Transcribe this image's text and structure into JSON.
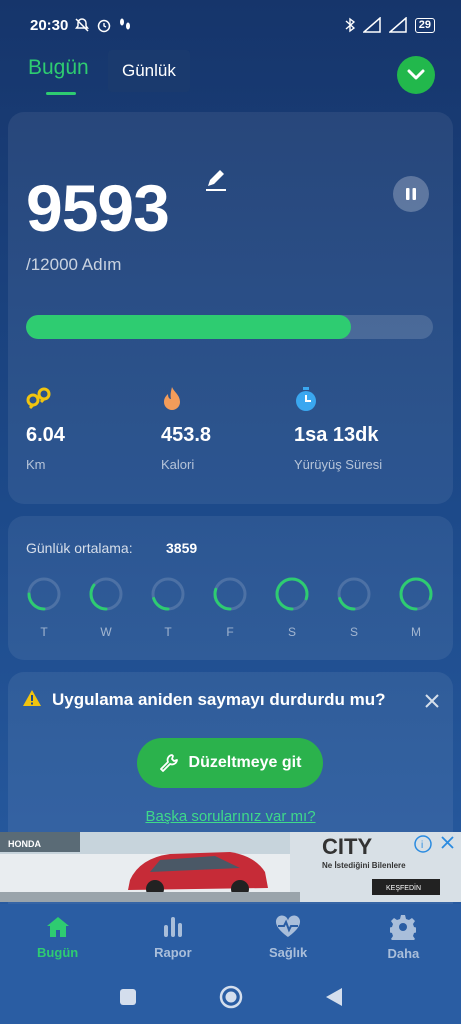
{
  "status_bar": {
    "time": "20:30",
    "battery": "29"
  },
  "tabs": {
    "today": "Bugün",
    "daily": "Günlük"
  },
  "steps": {
    "count": "9593",
    "goal_text": "/12000 Adım",
    "progress": 0.7994
  },
  "stats": [
    {
      "value": "6.04",
      "label": "Km",
      "icon": "distance-icon"
    },
    {
      "value": "453.8",
      "label": "Kalori",
      "icon": "fire-icon"
    },
    {
      "value": "1sa 13dk",
      "label": "Yürüyüş Süresi",
      "icon": "stopwatch-icon"
    }
  ],
  "daily_average": {
    "label": "Günlük ortalama:",
    "value": "3859",
    "days": [
      {
        "label": "T",
        "progress": 0.25
      },
      {
        "label": "W",
        "progress": 0.35
      },
      {
        "label": "T",
        "progress": 0.2
      },
      {
        "label": "F",
        "progress": 0.3
      },
      {
        "label": "S",
        "progress": 0.8
      },
      {
        "label": "S",
        "progress": 0.2
      },
      {
        "label": "M",
        "progress": 0.8
      }
    ]
  },
  "alert": {
    "title": "Uygulama aniden saymayı durdurdu mu?",
    "button": "Düzeltmeye git",
    "link": "Başka sorularınız var mı?"
  },
  "ad": {
    "brand": "HONDA",
    "model": "CITY",
    "tagline": "Ne İstediğini Bilenlere",
    "cta": "KEŞFEDİN"
  },
  "bottom_nav": [
    {
      "label": "Bugün",
      "icon": "home-icon"
    },
    {
      "label": "Rapor",
      "icon": "bar-chart-icon"
    },
    {
      "label": "Sağlık",
      "icon": "heart-pulse-icon"
    },
    {
      "label": "Daha",
      "icon": "gear-icon"
    }
  ],
  "colors": {
    "accent": "#2ecc71",
    "button": "#2bb24c",
    "background": "#1d4a8a"
  }
}
